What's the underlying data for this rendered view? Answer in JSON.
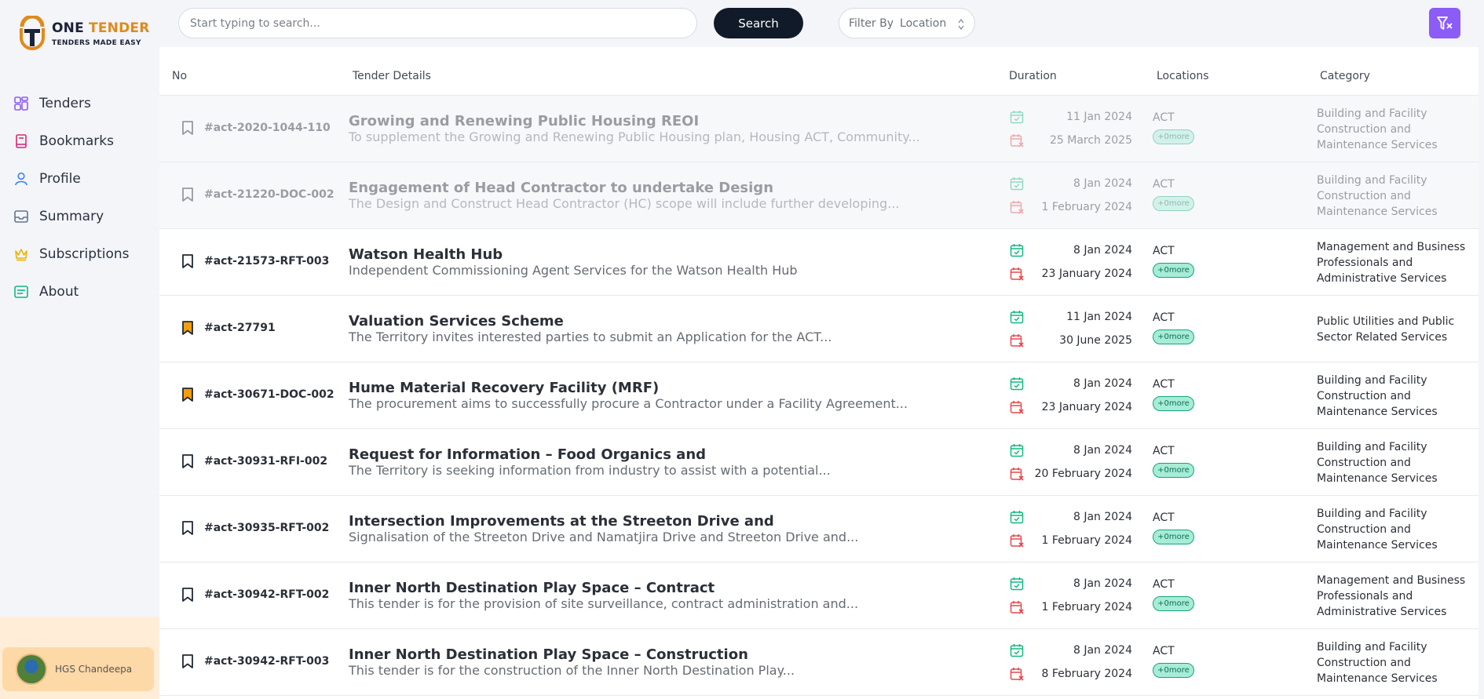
{
  "brand": {
    "name_part1": "ONE",
    "name_part2": "TENDER",
    "tagline": "TENDERS MADE EASY"
  },
  "nav": [
    {
      "label": "Tenders",
      "icon": "grid-icon",
      "color": "#8b5cf6"
    },
    {
      "label": "Bookmarks",
      "icon": "book-icon",
      "color": "#db2777"
    },
    {
      "label": "Profile",
      "icon": "user-icon",
      "color": "#3b82f6"
    },
    {
      "label": "Summary",
      "icon": "inbox-icon",
      "color": "#64748b"
    },
    {
      "label": "Subscriptions",
      "icon": "crown-icon",
      "color": "#eab308"
    },
    {
      "label": "About",
      "icon": "info-box-icon",
      "color": "#10b981"
    }
  ],
  "user": {
    "name": "HGS Chandeepa"
  },
  "search": {
    "placeholder": "Start typing to search...",
    "value": "",
    "button": "Search"
  },
  "filter": {
    "label": "Filter By",
    "value": "Location"
  },
  "table": {
    "headers": {
      "no": "No",
      "details": "Tender Details",
      "duration": "Duration",
      "locations": "Locations",
      "category": "Category"
    },
    "rows": [
      {
        "id": "#act-2020-1044-110",
        "title": "Growing and Renewing Public Housing REOI",
        "desc": "To supplement the Growing and Renewing Public Housing plan, Housing ACT, Community...",
        "start": "11 Jan 2024",
        "end": "25 March 2025",
        "location": "ACT",
        "more": "+0more",
        "category": "Building and Facility Construction and Maintenance Services",
        "muted": true,
        "bookmarked": false
      },
      {
        "id": "#act-21220-DOC-002",
        "title": "Engagement of Head Contractor to undertake Design",
        "desc": "The Design and Construct Head Contractor (HC) scope will include further developing...",
        "start": "8 Jan 2024",
        "end": "1 February 2024",
        "location": "ACT",
        "more": "+0more",
        "category": "Building and Facility Construction and Maintenance Services",
        "muted": true,
        "bookmarked": false
      },
      {
        "id": "#act-21573-RFT-003",
        "title": "Watson Health Hub",
        "desc": "Independent Commissioning Agent Services for the Watson Health Hub",
        "start": "8 Jan 2024",
        "end": "23 January 2024",
        "location": "ACT",
        "more": "+0more",
        "category": "Management and Business Professionals and Administrative Services",
        "muted": false,
        "bookmarked": false
      },
      {
        "id": "#act-27791",
        "title": "Valuation Services Scheme",
        "desc": "The Territory invites interested parties to submit an Application for the ACT...",
        "start": "11 Jan 2024",
        "end": "30 June 2025",
        "location": "ACT",
        "more": "+0more",
        "category": "Public Utilities and Public Sector Related Services",
        "muted": false,
        "bookmarked": true
      },
      {
        "id": "#act-30671-DOC-002",
        "title": "Hume Material Recovery Facility (MRF)",
        "desc": "The procurement aims to successfully procure a Contractor under a Facility Agreement...",
        "start": "8 Jan 2024",
        "end": "23 January 2024",
        "location": "ACT",
        "more": "+0more",
        "category": "Building and Facility Construction and Maintenance Services",
        "muted": false,
        "bookmarked": true
      },
      {
        "id": "#act-30931-RFI-002",
        "title": "Request for Information – Food Organics and",
        "desc": "The Territory is seeking information from industry to assist with a potential...",
        "start": "8 Jan 2024",
        "end": "20 February 2024",
        "location": "ACT",
        "more": "+0more",
        "category": "Building and Facility Construction and Maintenance Services",
        "muted": false,
        "bookmarked": false
      },
      {
        "id": "#act-30935-RFT-002",
        "title": "Intersection Improvements at the Streeton Drive and",
        "desc": "Signalisation of the Streeton Drive and Namatjira Drive and Streeton Drive and...",
        "start": "8 Jan 2024",
        "end": "1 February 2024",
        "location": "ACT",
        "more": "+0more",
        "category": "Building and Facility Construction and Maintenance Services",
        "muted": false,
        "bookmarked": false
      },
      {
        "id": "#act-30942-RFT-002",
        "title": "Inner North Destination Play Space – Contract",
        "desc": "This tender is for the provision of site surveillance, contract administration and...",
        "start": "8 Jan 2024",
        "end": "1 February 2024",
        "location": "ACT",
        "more": "+0more",
        "category": "Management and Business Professionals and Administrative Services",
        "muted": false,
        "bookmarked": false
      },
      {
        "id": "#act-30942-RFT-003",
        "title": "Inner North Destination Play Space – Construction",
        "desc": "This tender is for the construction of the Inner North Destination Play...",
        "start": "8 Jan 2024",
        "end": "8 February 2024",
        "location": "ACT",
        "more": "+0more",
        "category": "Building and Facility Construction and Maintenance Services",
        "muted": false,
        "bookmarked": false
      }
    ]
  },
  "colors": {
    "accent": "#8b5cf6",
    "brand_orange": "#e08a1c",
    "navy": "#111a28",
    "start_green": "#10b981",
    "end_red": "#e5484d",
    "bookmark_active": "#f59e0b"
  }
}
